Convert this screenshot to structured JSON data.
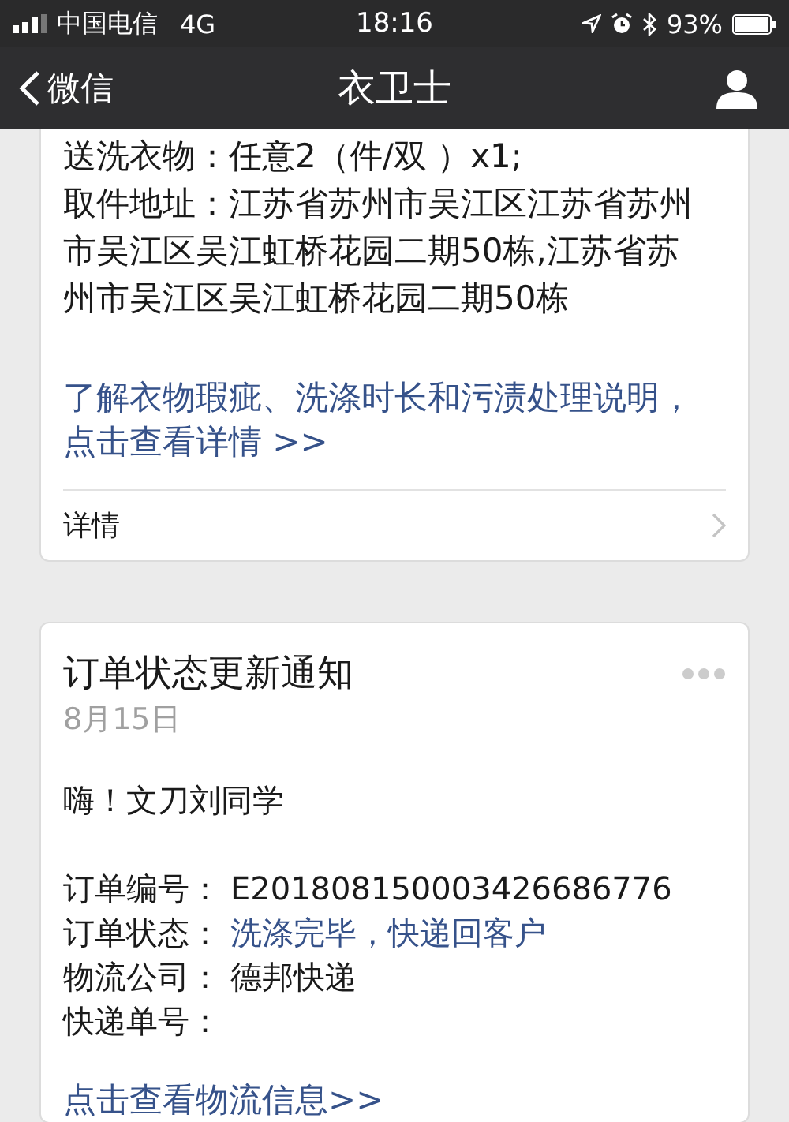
{
  "status_bar": {
    "carrier": "中国电信",
    "network": "4G",
    "time": "18:16",
    "battery": "93%"
  },
  "nav": {
    "back": "微信",
    "title": "衣卫士"
  },
  "card_1": {
    "lines": [
      "送洗衣物：任意2（件/双 ）x1;",
      "取件地址：江苏省苏州市吴江区江苏省苏州市吴江区吴江虹桥花园二期50栋,江苏省苏州市吴江区吴江虹桥花园二期50栋"
    ],
    "link": "了解衣物瑕疵、洗涤时长和污渍处理说明，点击查看详情 >>",
    "footer": "详情"
  },
  "card_2": {
    "title": "订单状态更新通知",
    "date": "8月15日",
    "greeting": "嗨！文刀刘同学",
    "rows": [
      {
        "label": "订单编号：",
        "value": "E201808150003426686776",
        "kind": "plain"
      },
      {
        "label": "订单状态：",
        "value": "洗涤完毕，快递回客户",
        "kind": "link"
      },
      {
        "label": "物流公司：",
        "value": "德邦快递",
        "kind": "plain"
      },
      {
        "label": "快递单号：",
        "kind": "plain"
      }
    ],
    "link": "点击查看物流信息>>"
  }
}
